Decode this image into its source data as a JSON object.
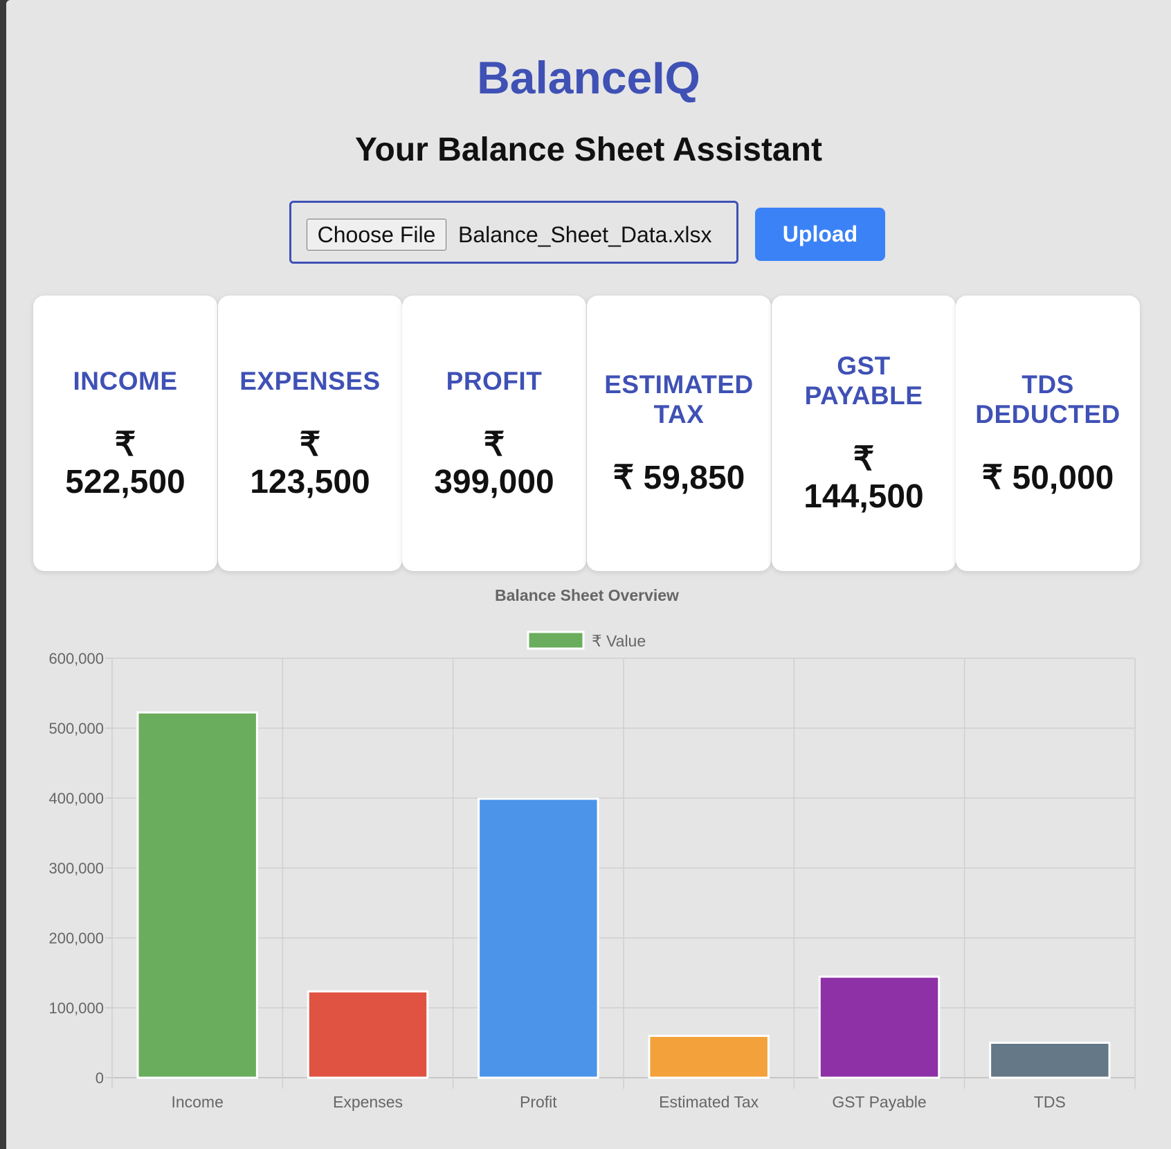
{
  "app": {
    "title": "BalanceIQ",
    "subtitle": "Your Balance Sheet Assistant"
  },
  "upload": {
    "choose_label": "Choose File",
    "file_name": "Balance_Sheet_Data.xlsx",
    "button_label": "Upload"
  },
  "cards": [
    {
      "label": "INCOME",
      "value": "₹ 522,500"
    },
    {
      "label": "EXPENSES",
      "value": "₹ 123,500"
    },
    {
      "label": "PROFIT",
      "value": "₹ 399,000"
    },
    {
      "label": "ESTIMATED TAX",
      "value": "₹ 59,850"
    },
    {
      "label": "GST PAYABLE",
      "value": "₹ 144,500"
    },
    {
      "label": "TDS DEDUCTED",
      "value": "₹ 50,000"
    }
  ],
  "colors": {
    "accent": "#3f51b5",
    "upload_button": "#3b82f6",
    "bars": [
      "#6aad5c",
      "#e05342",
      "#4b94ea",
      "#f3a13a",
      "#8e30a6",
      "#647887"
    ]
  },
  "chart_data": {
    "type": "bar",
    "title": "Balance Sheet Overview",
    "categories": [
      "Income",
      "Expenses",
      "Profit",
      "Estimated Tax",
      "GST Payable",
      "TDS"
    ],
    "series": [
      {
        "name": "₹ Value",
        "values": [
          522500,
          123500,
          399000,
          59850,
          144500,
          50000
        ]
      }
    ],
    "ylim": [
      0,
      600000
    ],
    "yticks": [
      0,
      100000,
      200000,
      300000,
      400000,
      500000,
      600000
    ],
    "ytick_labels": [
      "0",
      "100,000",
      "200,000",
      "300,000",
      "400,000",
      "500,000",
      "600,000"
    ],
    "grid": true,
    "legend": "top-center"
  }
}
